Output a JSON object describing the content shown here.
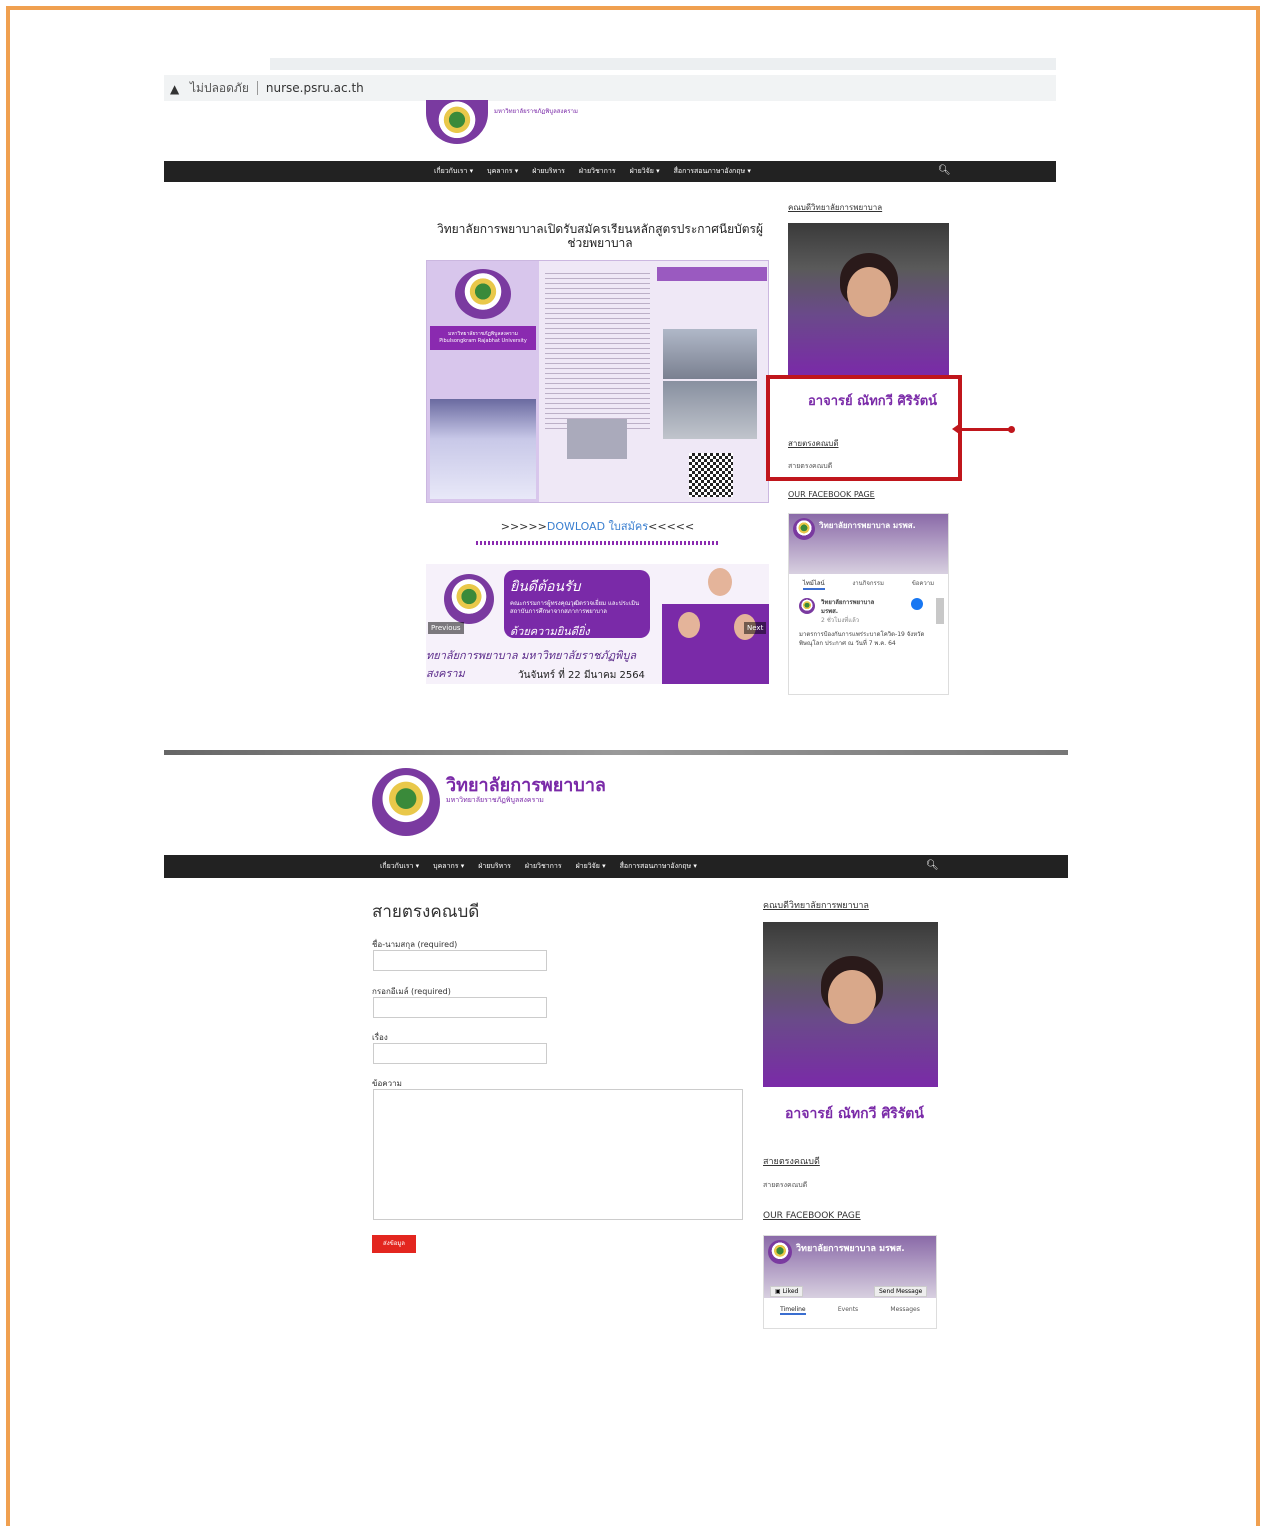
{
  "browser": {
    "security_label": "ไม่ปลอดภัย",
    "url": "nurse.psru.ac.th"
  },
  "top_site": {
    "logo_subtitle": "มหาวิทยาลัยราชภัฏพิบูลสงคราม",
    "nav": [
      "เกี่ยวกับเรา ▾",
      "บุคลากร ▾",
      "ฝ่ายบริหาร",
      "ฝ่ายวิชาการ",
      "ฝ่ายวิจัย ▾",
      "สื่อการสอนภาษาอังกฤษ ▾"
    ],
    "post_title": "วิทยาลัยการพยาบาลเปิดรับสมัครเรียนหลักสูตรประกาศนียบัตรผู้ช่วยพยาบาล",
    "poster_banner": "มหาวิทยาลัยราชภัฏพิบูลสงคราม Pibulsongkram Rajabhat University",
    "download_prefix": ">>>>>",
    "download_link": "DOWLOAD ใบสมัคร",
    "download_suffix": "<<<<<",
    "slider": {
      "headline": "ยินดีต้อนรับ",
      "body": "คณะกรรมการผู้ทรงคุณวุฒิตรวจเยี่ยม และประเมินสถาบันการศึกษาจากสภาการพยาบาล",
      "tagline": "ด้วยความยินดียิ่ง",
      "strip": "ทยาลัยการพยาบาล มหาวิทยาลัยราชภัฏพิบูลสงคราม",
      "date": "วันจันทร์ ที่ 22 มีนาคม 2564",
      "prev": "Previous",
      "next": "Next"
    },
    "sidebar": {
      "dean_heading": "คณบดีวิทยาลัยการพยาบาล",
      "dean_name": "อาจารย์ ณัทกวี ศิริรัตน์",
      "hotline_heading": "สายตรงคณบดี",
      "hotline_text": "สายตรงคณบดี",
      "fb_heading": "OUR FACEBOOK PAGE",
      "fb_page_name": "วิทยาลัยการพยาบาล มรพส.",
      "fb_tabs": [
        "ไทม์ไลน์",
        "งานกิจกรรม",
        "ข้อความ"
      ],
      "fb_post_author": "วิทยาลัยการพยาบาล มรพส.",
      "fb_post_time": "2 ชั่วโมงที่แล้ว",
      "fb_post_text": "มาตรการป้องกันการแพร่ระบาดโควิด-19 จังหวัดพิษณุโลก ประกาศ ณ วันที่ 7 พ.ค. 64"
    }
  },
  "bottom_site": {
    "brand": "วิทยาลัยการพยาบาล",
    "brand_sub": "มหาวิทยาลัยราชภัฏพิบูลสงคราม",
    "nav": [
      "เกี่ยวกับเรา ▾",
      "บุคลากร ▾",
      "ฝ่ายบริหาร",
      "ฝ่ายวิชาการ",
      "ฝ่ายวิจัย ▾",
      "สื่อการสอนภาษาอังกฤษ ▾"
    ],
    "form": {
      "title": "สายตรงคณบดี",
      "name_label": "ชื่อ-นามสกุล (required)",
      "email_label": "กรอกอีเมล์ (required)",
      "subject_label": "เรื่อง",
      "message_label": "ข้อความ",
      "submit": "ส่งข้อมูล"
    },
    "sidebar": {
      "dean_heading": "คณบดีวิทยาลัยการพยาบาล",
      "dean_name": "อาจารย์ ณัทกวี ศิริรัตน์",
      "hotline_heading": "สายตรงคณบดี",
      "hotline_text": "สายตรงคณบดี",
      "fb_heading": "OUR FACEBOOK PAGE",
      "fb_page_name": "วิทยาลัยการพยาบาล มรพส.",
      "fb_liked": "Liked",
      "fb_send": "Send Message",
      "fb_tabs": [
        "Timeline",
        "Events",
        "Messages"
      ]
    }
  },
  "colors": {
    "accent_purple": "#7a2aa8",
    "highlight_red": "#c0161c",
    "frame_orange": "#f0a050",
    "nav_bg": "#222222",
    "submit_red": "#e3261f"
  }
}
